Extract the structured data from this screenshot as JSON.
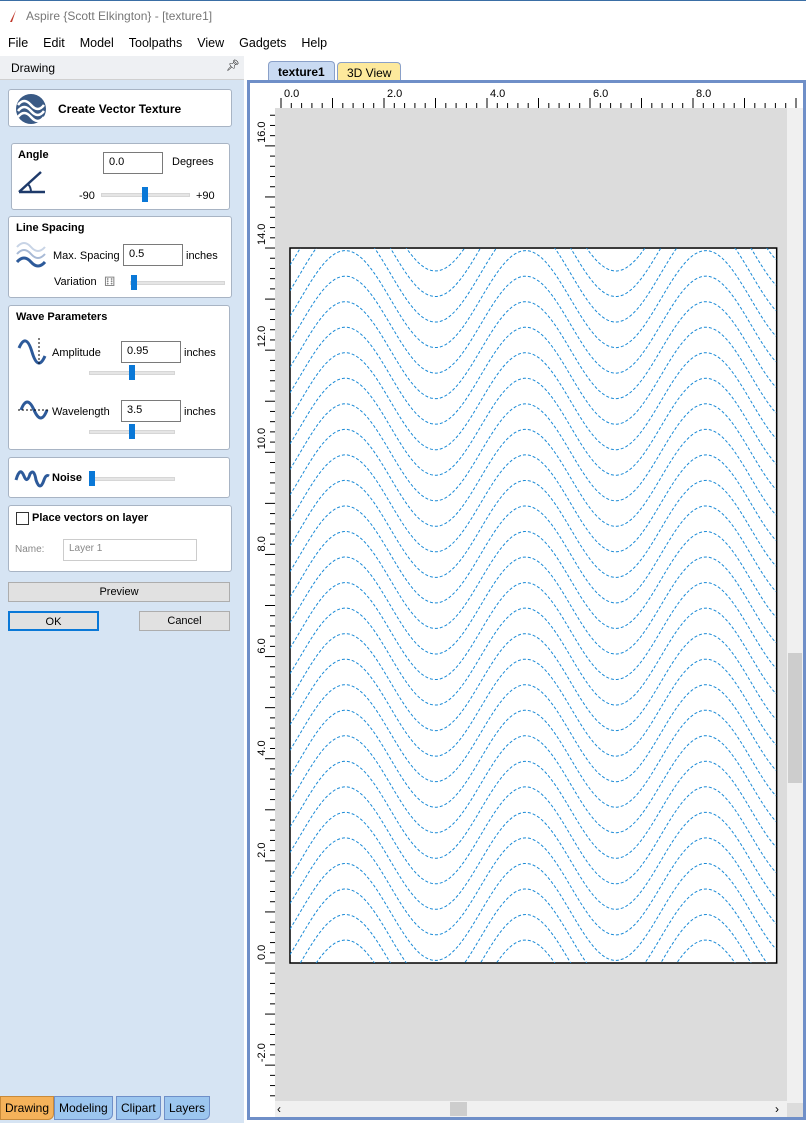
{
  "window": {
    "title": "Aspire {Scott Elkington} - [texture1]"
  },
  "menu": [
    "File",
    "Edit",
    "Model",
    "Toolpaths",
    "View",
    "Gadgets",
    "Help"
  ],
  "panel": {
    "header": "Drawing",
    "title": "Create Vector Texture",
    "angle": {
      "label": "Angle",
      "value": "0.0",
      "unit": "Degrees",
      "min": "-90",
      "max": "+90",
      "slider_value": 0
    },
    "spacing": {
      "label": "Line Spacing",
      "max_label": "Max. Spacing",
      "value": "0.5",
      "unit": "inches",
      "variation_label": "Variation",
      "variation_value": 0
    },
    "wave": {
      "label": "Wave Parameters",
      "amp_label": "Amplitude",
      "amp_value": "0.95",
      "amp_unit": "inches",
      "wl_label": "Wavelength",
      "wl_value": "3.5",
      "wl_unit": "inches"
    },
    "noise": {
      "label": "Noise",
      "value": 0
    },
    "layer": {
      "checkbox_label": "Place vectors on layer",
      "checked": false,
      "name_label": "Name:",
      "name_placeholder": "Layer 1"
    },
    "preview": "Preview",
    "ok": "OK",
    "cancel": "Cancel"
  },
  "bottom_tabs": [
    "Drawing",
    "Modeling",
    "Clipart",
    "Layers"
  ],
  "view_tabs": [
    "texture1",
    "3D View"
  ],
  "ruler": {
    "x_labels": [
      "0.0",
      "2.0",
      "4.0",
      "6.0",
      "8.0"
    ],
    "y_labels": [
      "16.0",
      "14.0",
      "12.0",
      "10.0",
      "8.0",
      "6.0",
      "4.0",
      "2.0",
      "0.0",
      "-2.0"
    ]
  },
  "colors": {
    "wave": "#1a8ad6",
    "accent": "#0a78d7"
  }
}
